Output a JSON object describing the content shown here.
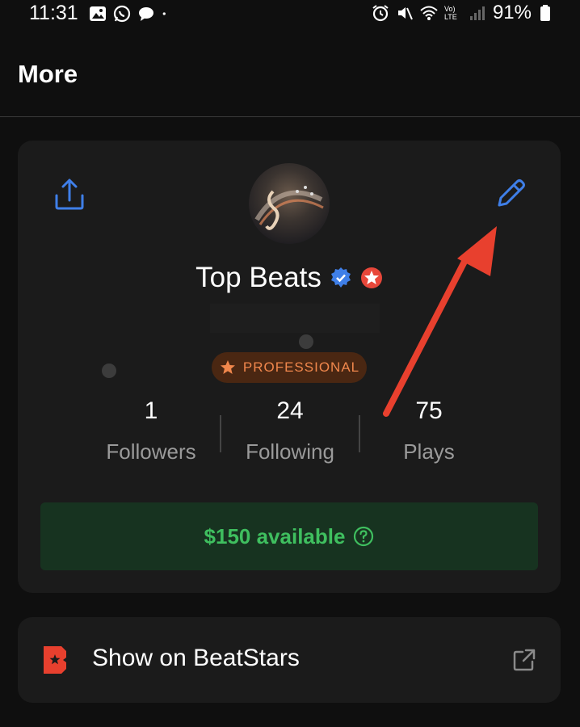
{
  "status_bar": {
    "time": "11:31",
    "battery": "91%",
    "network": "Vo) LTE"
  },
  "header": {
    "title": "More"
  },
  "profile": {
    "name": "Top Beats",
    "badge": "PROFESSIONAL",
    "stats": [
      {
        "value": "1",
        "label": "Followers"
      },
      {
        "value": "24",
        "label": "Following"
      },
      {
        "value": "75",
        "label": "Plays"
      }
    ],
    "balance": "$150 available"
  },
  "links": {
    "beatstars_label": "Show on BeatStars"
  },
  "colors": {
    "accent_blue": "#3f7fe8",
    "pro_orange": "#f0874c",
    "balance_green": "#3fbf5f",
    "annotation_red": "#e8402e"
  }
}
